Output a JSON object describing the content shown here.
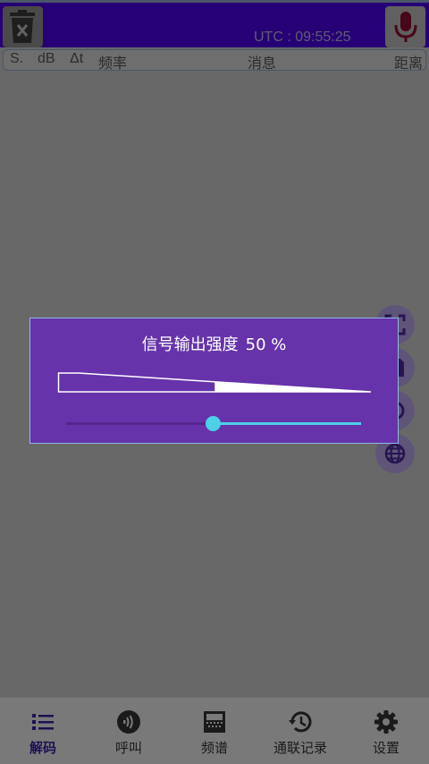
{
  "appbar": {
    "utc_label": "UTC : 09:55:25",
    "clear_icon": "trash-x-icon",
    "mic_icon": "microphone-icon",
    "color": "#4a00e0"
  },
  "columns": [
    "S.",
    "dB",
    "Δt",
    "频率",
    "消息",
    "距离"
  ],
  "side_buttons": [
    "fullscreen-icon",
    "save-icon",
    "target-icon",
    "globe-icon"
  ],
  "dialog": {
    "title": "信号输出强度",
    "value_label": "50 %",
    "strength_fraction": 0.5,
    "accent": "#4dd0e8",
    "background": "#6633aa"
  },
  "bottom_nav": [
    {
      "label": "解码",
      "icon": "list-icon",
      "active": true
    },
    {
      "label": "呼叫",
      "icon": "call-signal-icon",
      "active": false
    },
    {
      "label": "频谱",
      "icon": "spectrum-icon",
      "active": false
    },
    {
      "label": "通联记录",
      "icon": "history-icon",
      "active": false
    },
    {
      "label": "设置",
      "icon": "gear-icon",
      "active": false
    }
  ]
}
